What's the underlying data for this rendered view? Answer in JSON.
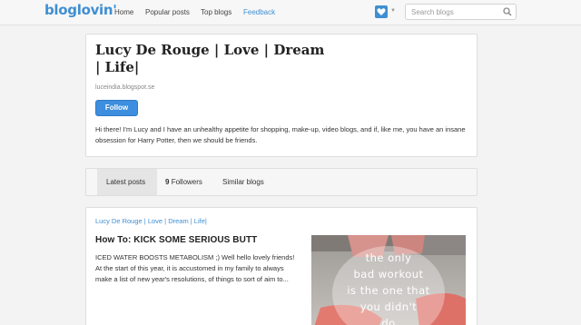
{
  "nav": {
    "logo": "bloglovin'",
    "items": [
      "Home",
      "Popular posts",
      "Top blogs",
      "Feedback"
    ],
    "search_placeholder": "Search blogs",
    "accent": "#3f8fd2"
  },
  "profile": {
    "title": "Lucy De Rouge | Love | Dream | Life|",
    "url": "luceindia.blogspot.se",
    "follow_label": "Follow",
    "description": "Hi there! I'm Lucy and I have an unhealthy appetite for shopping, make-up, video blogs, and if, like me, you have an insane obsession for Harry Potter, then we should be friends."
  },
  "tabs": {
    "latest": "Latest posts",
    "followers_count": "9",
    "followers_label": "Followers",
    "similar": "Similar blogs"
  },
  "post": {
    "source": "Lucy De Rouge | Love | Dream | Life|",
    "title": "How To: KICK SOME SERIOUS BUTT",
    "excerpt": "ICED WATER BOOSTS METABOLISM ;) Well hello lovely friends! At the start of this year, it is accustomed in my family to always make a list of new year's resolutions, of things to sort of aim to...",
    "image_text": [
      "the only",
      "bad workout",
      "is the one that",
      "you didn't",
      "do"
    ]
  }
}
